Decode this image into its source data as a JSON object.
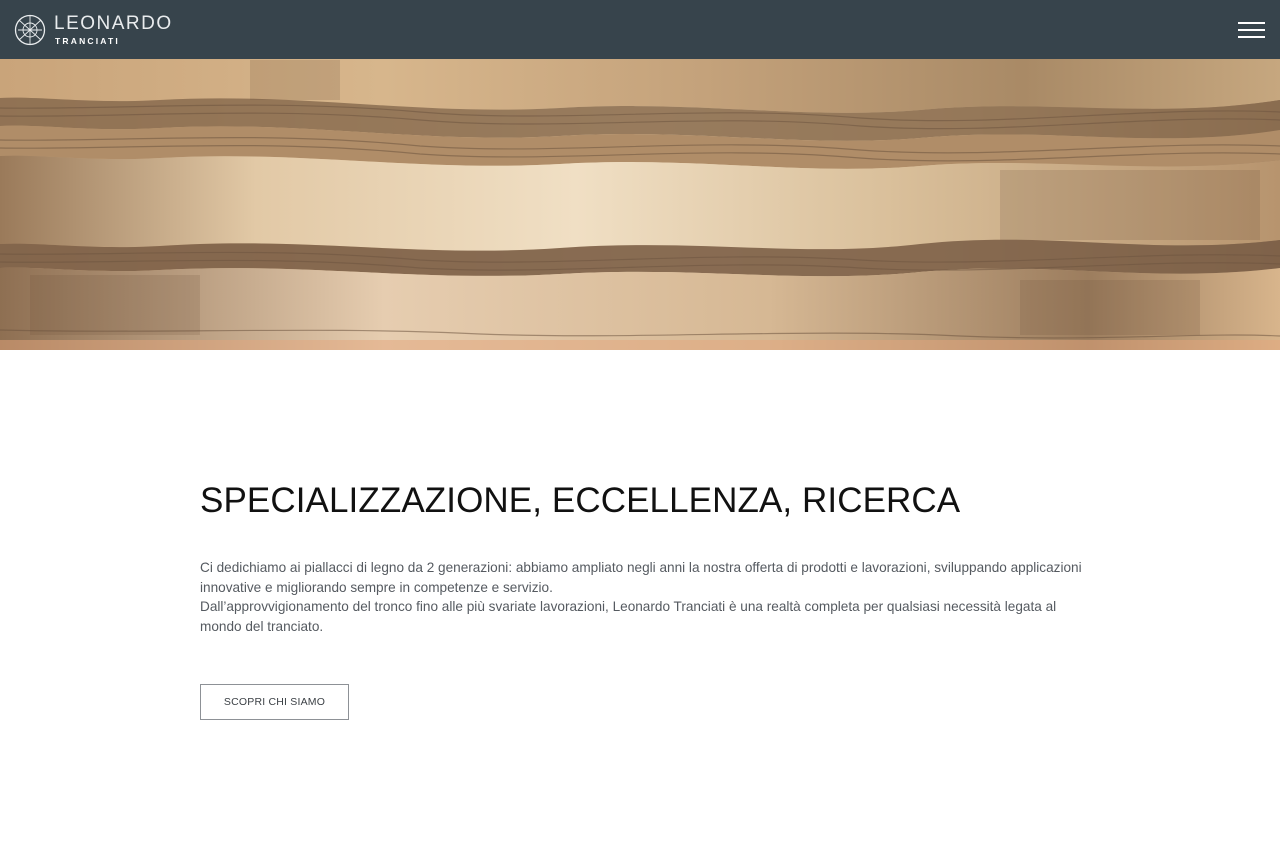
{
  "header": {
    "brand_name": "LEONARDO",
    "brand_sub": "TRANCIATI",
    "background_color": "#37444c",
    "menu_icon": "hamburger-menu-icon"
  },
  "hero": {
    "image_description_icon": "wood-veneer-layers-image"
  },
  "main": {
    "headline": "SPECIALIZZAZIONE, ECCELLENZA, RICERCA",
    "paragraph_1": "Ci dedichiamo ai piallacci di legno da 2 generazioni: abbiamo ampliato negli anni la nostra offerta di prodotti e lavorazioni, sviluppando applicazioni innovative e migliorando sempre in competenze e servizio.",
    "paragraph_2": "Dall’approvvigionamento del tronco fino alle più svariate lavorazioni, Leonardo Tranciati è una realtà completa per qualsiasi necessità legata al mondo del tranciato.",
    "cta_label": "SCOPRI CHI SIAMO"
  }
}
